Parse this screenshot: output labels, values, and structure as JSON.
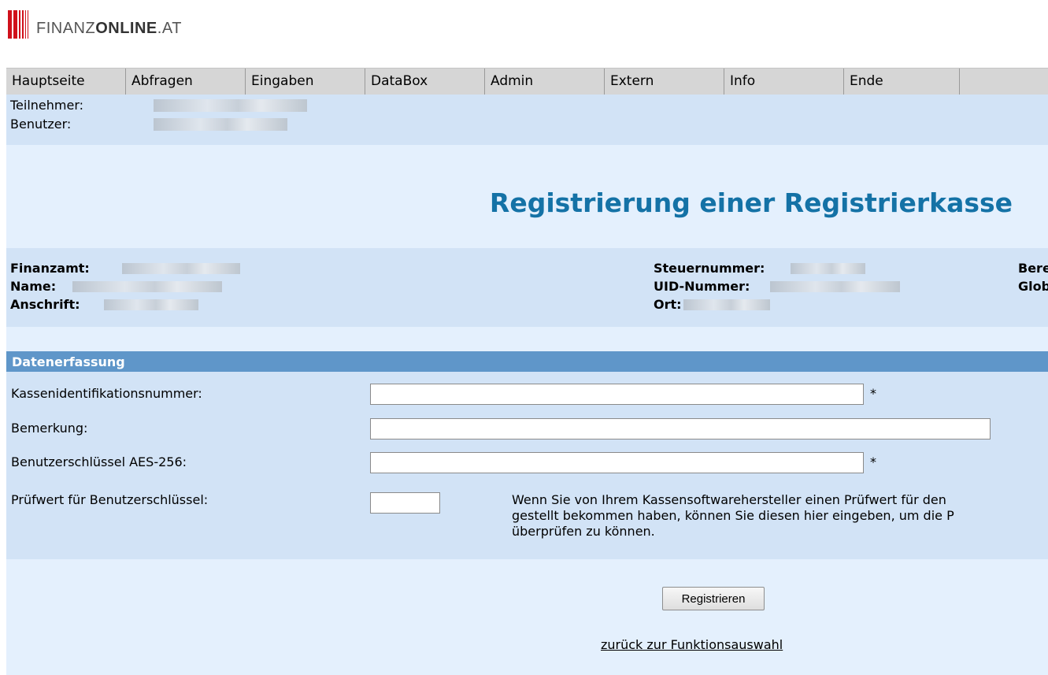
{
  "logo": {
    "text_regular": "FINANZ",
    "text_bold": "ONLINE",
    "text_suffix": ".AT",
    "color": "#d0111b"
  },
  "menu": [
    "Hauptseite",
    "Abfragen",
    "Eingaben",
    "DataBox",
    "Admin",
    "Extern",
    "Info",
    "Ende"
  ],
  "user": {
    "participant_label": "Teilnehmer:",
    "user_label": "Benutzer:"
  },
  "page_title": "Registrierung einer Registrierkasse",
  "taxpayer": {
    "finanzamt_label": "Finanzamt:",
    "name_label": "Name:",
    "anschrift_label": "Anschrift:",
    "steuernummer_label": "Steuernummer:",
    "uid_label": "UID-Nummer:",
    "ort_label": "Ort:",
    "right_label_1": "Bere",
    "right_label_2": "Glob"
  },
  "section_title": "Datenerfassung",
  "form": {
    "kassen_id_label": "Kassenidentifikationsnummer:",
    "bemerkung_label": "Bemerkung:",
    "aes_label": "Benutzerschlüssel AES-256:",
    "pruefwert_label": "Prüfwert für Benutzerschlüssel:",
    "required_mark": "*",
    "hint": "Wenn Sie von Ihrem Kassensoftwarehersteller einen Prüfwert für den\ngestellt bekommen haben, können Sie diesen hier eingeben, um die P\nüberprüfen zu können."
  },
  "submit_label": "Registrieren",
  "back_link": "zurück zur Funktionsauswahl",
  "colors": {
    "accent": "#1472a6",
    "section_header": "#5f96c9",
    "panel": "#d2e3f6",
    "background": "#e4f0fd"
  }
}
